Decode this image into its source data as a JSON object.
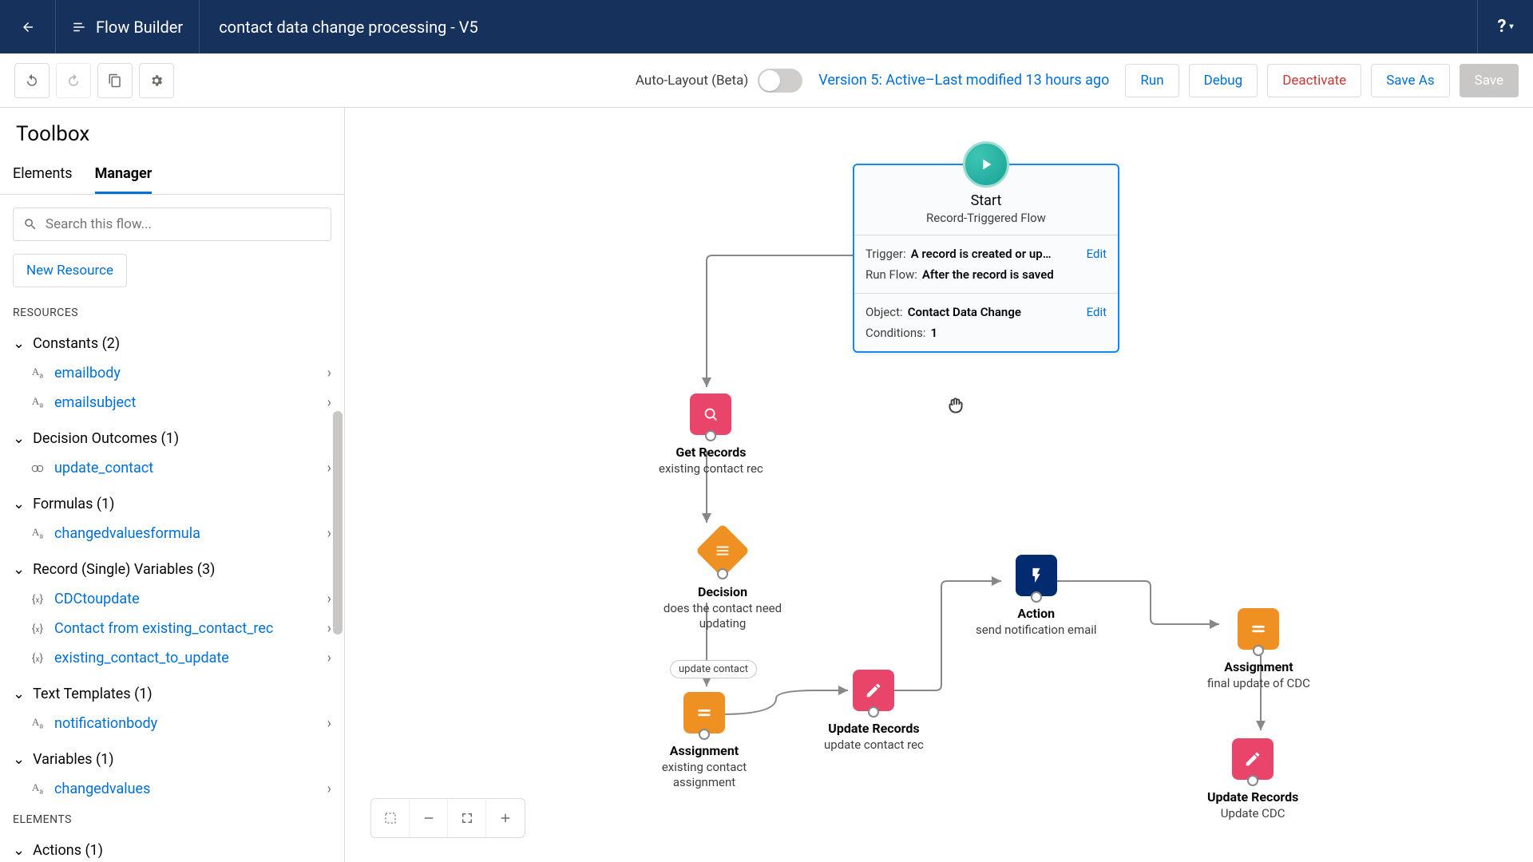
{
  "header": {
    "app_title": "Flow Builder",
    "flow_name": "contact data change processing - V5",
    "help": "?"
  },
  "toolbar": {
    "auto_layout_label": "Auto-Layout (Beta)",
    "version_info": "Version 5: Active–Last modified 13 hours ago",
    "run": "Run",
    "debug": "Debug",
    "deactivate": "Deactivate",
    "save_as": "Save As",
    "save": "Save"
  },
  "sidebar": {
    "title": "Toolbox",
    "tabs": {
      "elements": "Elements",
      "manager": "Manager"
    },
    "search_placeholder": "Search this flow...",
    "new_resource": "New Resource",
    "sections": {
      "resources": "RESOURCES",
      "elements": "ELEMENTS"
    },
    "groups": [
      {
        "label": "Constants (2)",
        "items": [
          {
            "label": "emailbody",
            "icon": "text"
          },
          {
            "label": "emailsubject",
            "icon": "text"
          }
        ]
      },
      {
        "label": "Decision Outcomes (1)",
        "items": [
          {
            "label": "update_contact",
            "icon": "outcome"
          }
        ]
      },
      {
        "label": "Formulas (1)",
        "items": [
          {
            "label": "changedvaluesformula",
            "icon": "text"
          }
        ]
      },
      {
        "label": "Record (Single) Variables (3)",
        "items": [
          {
            "label": "CDCtoupdate",
            "icon": "record"
          },
          {
            "label": "Contact from existing_contact_rec",
            "icon": "record"
          },
          {
            "label": "existing_contact_to_update",
            "icon": "record"
          }
        ]
      },
      {
        "label": "Text Templates (1)",
        "items": [
          {
            "label": "notificationbody",
            "icon": "text"
          }
        ]
      },
      {
        "label": "Variables (1)",
        "items": [
          {
            "label": "changedvalues",
            "icon": "text"
          }
        ]
      }
    ],
    "elements_group": {
      "label": "Actions (1)"
    }
  },
  "start_card": {
    "title": "Start",
    "subtitle": "Record-Triggered Flow",
    "trigger_label": "Trigger:",
    "trigger_value": "A record is created or up…",
    "runflow_label": "Run Flow:",
    "runflow_value": "After the record is saved",
    "object_label": "Object:",
    "object_value": "Contact Data Change",
    "conditions_label": "Conditions:",
    "conditions_value": "1",
    "edit": "Edit"
  },
  "nodes": {
    "get_records": {
      "title": "Get Records",
      "sub": "existing contact rec"
    },
    "decision": {
      "title": "Decision",
      "sub": "does the contact need updating",
      "path_label": "update contact"
    },
    "assignment1": {
      "title": "Assignment",
      "sub": "existing contact assignment"
    },
    "update1": {
      "title": "Update Records",
      "sub": "update contact rec"
    },
    "action": {
      "title": "Action",
      "sub": "send notification email"
    },
    "assignment2": {
      "title": "Assignment",
      "sub": "final update of CDC"
    },
    "update2": {
      "title": "Update Records",
      "sub": "Update CDC"
    }
  }
}
